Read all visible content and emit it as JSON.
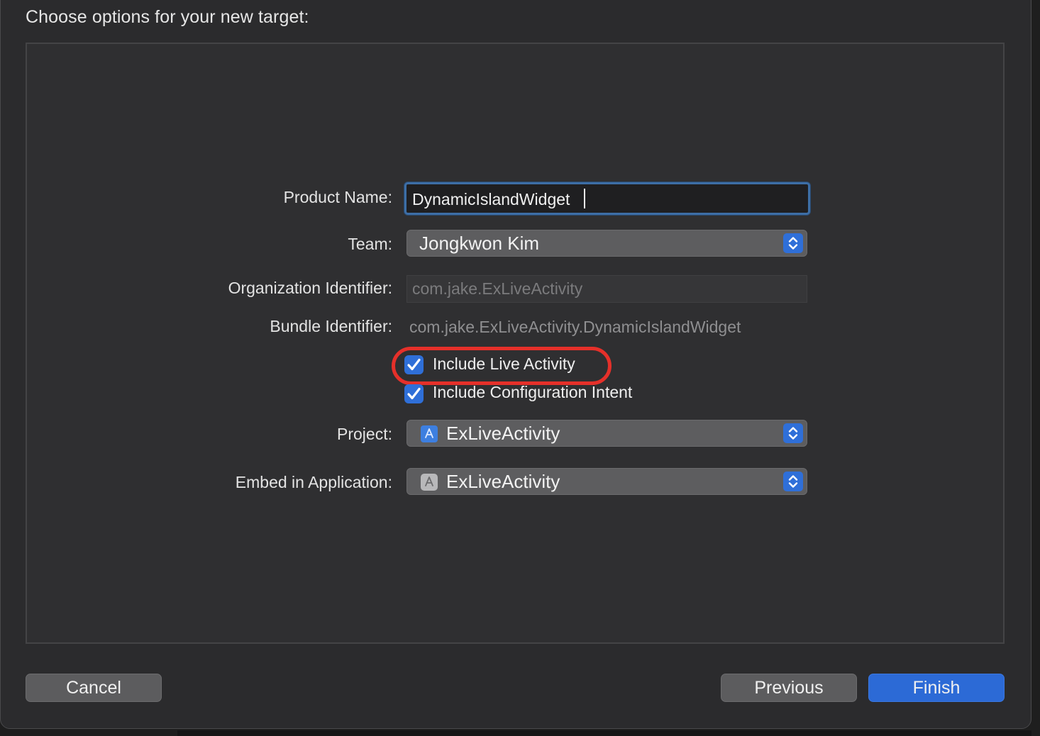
{
  "dialog": {
    "title": "Choose options for your new target:"
  },
  "form": {
    "product_name": {
      "label": "Product Name:",
      "value": "DynamicIslandWidget"
    },
    "team": {
      "label": "Team:",
      "value": "Jongkwon Kim"
    },
    "organization_identifier": {
      "label": "Organization Identifier:",
      "value": "com.jake.ExLiveActivity"
    },
    "bundle_identifier": {
      "label": "Bundle Identifier:",
      "value": "com.jake.ExLiveActivity.DynamicIslandWidget"
    },
    "include_live_activity": {
      "label": "Include Live Activity",
      "checked": true
    },
    "include_configuration_intent": {
      "label": "Include Configuration Intent",
      "checked": true
    },
    "project": {
      "label": "Project:",
      "value": "ExLiveActivity",
      "icon": "xcode-project-icon"
    },
    "embed_in_application": {
      "label": "Embed in Application:",
      "value": "ExLiveActivity",
      "icon": "app-icon"
    }
  },
  "buttons": {
    "cancel": "Cancel",
    "previous": "Previous",
    "finish": "Finish"
  },
  "colors": {
    "accent": "#2c6ad6",
    "highlight_ring": "#e5302a"
  }
}
